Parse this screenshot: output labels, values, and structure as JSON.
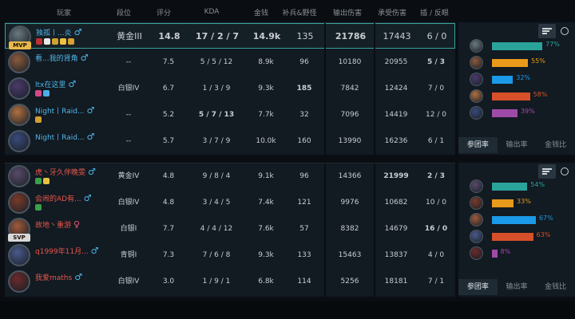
{
  "headers": {
    "player": "玩家",
    "rank": "段位",
    "score": "评分",
    "kda": "KDA",
    "gold": "金钱",
    "cs": "补兵&野怪",
    "dmg": "输出伤害",
    "taken": "承受伤害",
    "wards": "插 / 反眼"
  },
  "team_a": [
    {
      "name": "独孤丨...炎",
      "gender": "♂",
      "badge": "MVP",
      "rank": "黄金III",
      "score": "14.8",
      "kda": "17 / 2 / 7",
      "gold": "14.9k",
      "cs": "135",
      "dmg": "21786",
      "taken": "17443",
      "wards": "6 / 0",
      "avatar_color": "#6a7a7e"
    },
    {
      "name": "看...我的肾角",
      "gender": "♂",
      "badge": "",
      "rank": "--",
      "score": "7.5",
      "kda": "5 / 5 / 12",
      "gold": "8.9k",
      "cs": "96",
      "dmg": "10180",
      "taken": "20955",
      "wards": "5 / 3",
      "avatar_color": "#8a5a3a"
    },
    {
      "name": "ltx在这里",
      "gender": "♂",
      "badge": "",
      "rank": "白银IV",
      "score": "6.7",
      "kda": "1 / 3 / 9",
      "gold": "9.3k",
      "cs": "185",
      "dmg": "7842",
      "taken": "12424",
      "wards": "7 / 0",
      "avatar_color": "#4a3a6a"
    },
    {
      "name": "Night丨Raid...",
      "gender": "♂",
      "badge": "",
      "rank": "--",
      "score": "5.2",
      "kda": "5 / 7 / 13",
      "gold": "7.7k",
      "cs": "32",
      "dmg": "7096",
      "taken": "14419",
      "wards": "12 / 0",
      "avatar_color": "#b07040"
    },
    {
      "name": "Night丨Raid...",
      "gender": "♂",
      "badge": "",
      "rank": "--",
      "score": "5.7",
      "kda": "3 / 7 / 9",
      "gold": "10.0k",
      "cs": "160",
      "dmg": "13990",
      "taken": "16236",
      "wards": "6 / 1",
      "avatar_color": "#3a4a7a"
    }
  ],
  "team_b": [
    {
      "name": "虎丶牙久伴晚雯",
      "gender": "♂",
      "badge": "",
      "rank": "黄金IV",
      "score": "4.8",
      "kda": "9 / 8 / 4",
      "gold": "9.1k",
      "cs": "96",
      "dmg": "14366",
      "taken": "21999",
      "wards": "2 / 3",
      "avatar_color": "#5a4a6a"
    },
    {
      "name": "会闹的AD有...",
      "gender": "♂",
      "badge": "",
      "rank": "白银IV",
      "score": "4.8",
      "kda": "3 / 4 / 5",
      "gold": "7.4k",
      "cs": "121",
      "dmg": "9976",
      "taken": "10682",
      "wards": "10 / 0",
      "avatar_color": "#7a3a2a"
    },
    {
      "name": "故地丶重游",
      "gender": "♀",
      "badge": "SVP",
      "rank": "白银I",
      "score": "7.7",
      "kda": "4 / 4 / 12",
      "gold": "7.6k",
      "cs": "57",
      "dmg": "8382",
      "taken": "14679",
      "wards": "16 / 0",
      "avatar_color": "#a05a3a"
    },
    {
      "name": "q1999年11月...",
      "gender": "♂",
      "badge": "",
      "rank": "青铜I",
      "score": "7.3",
      "kda": "7 / 6 / 8",
      "gold": "9.3k",
      "cs": "133",
      "dmg": "15463",
      "taken": "13837",
      "wards": "4 / 0",
      "avatar_color": "#4a5a8a"
    },
    {
      "name": "我爱maths",
      "gender": "♂",
      "badge": "",
      "rank": "白银IV",
      "score": "3.0",
      "kda": "1 / 9 / 1",
      "gold": "6.8k",
      "cs": "114",
      "dmg": "5256",
      "taken": "18181",
      "wards": "7 / 1",
      "avatar_color": "#6a2a2a"
    }
  ],
  "side_a": {
    "tabs": [
      "参团率",
      "输出率",
      "金钱比"
    ],
    "bars": [
      {
        "pct": "77%",
        "value": 77,
        "color": "#2aa39a",
        "avatar_color": "#6a7a7e"
      },
      {
        "pct": "55%",
        "value": 55,
        "color": "#e89a1a",
        "avatar_color": "#8a5a3a"
      },
      {
        "pct": "32%",
        "value": 32,
        "color": "#1a9ae8",
        "avatar_color": "#4a3a6a"
      },
      {
        "pct": "58%",
        "value": 58,
        "color": "#d8502a",
        "avatar_color": "#b07040"
      },
      {
        "pct": "39%",
        "value": 39,
        "color": "#a04aa8",
        "avatar_color": "#3a4a7a"
      }
    ]
  },
  "side_b": {
    "tabs": [
      "参团率",
      "输出率",
      "金钱比"
    ],
    "bars": [
      {
        "pct": "54%",
        "value": 54,
        "color": "#2aa39a",
        "avatar_color": "#5a4a6a"
      },
      {
        "pct": "33%",
        "value": 33,
        "color": "#e89a1a",
        "avatar_color": "#7a3a2a"
      },
      {
        "pct": "67%",
        "value": 67,
        "color": "#1a9ae8",
        "avatar_color": "#a05a3a"
      },
      {
        "pct": "63%",
        "value": 63,
        "color": "#d8502a",
        "avatar_color": "#4a5a8a"
      },
      {
        "pct": "8%",
        "value": 8,
        "color": "#a04aa8",
        "avatar_color": "#6a2a2a"
      }
    ]
  }
}
